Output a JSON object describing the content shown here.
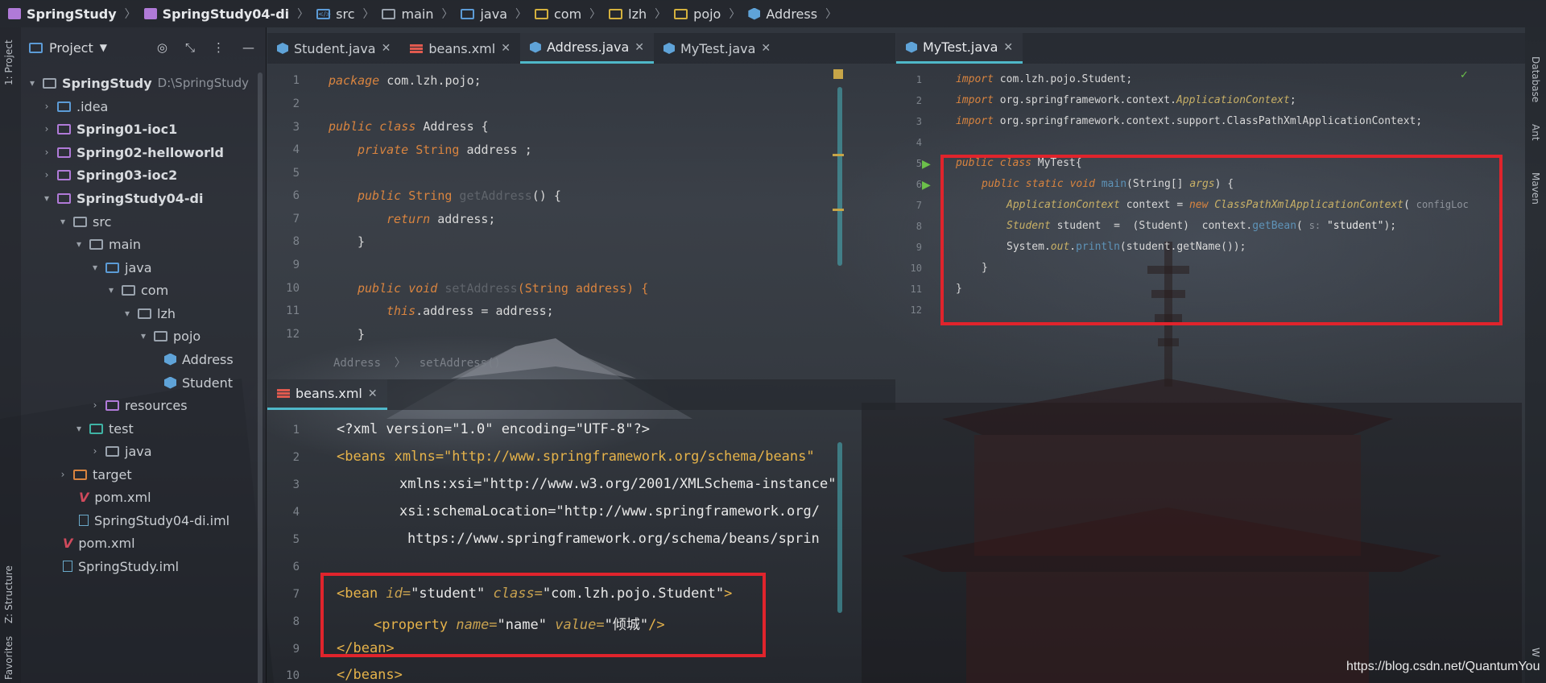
{
  "breadcrumb": [
    "SpringStudy",
    "SpringStudy04-di",
    "src",
    "main",
    "java",
    "com",
    "lzh",
    "pojo",
    "Address"
  ],
  "left_stripe": {
    "project_tab": "1: Project",
    "structure_tab": "Z: Structure",
    "favorites_tab": "Favorites"
  },
  "right_stripe": {
    "database_tab": "Database",
    "ant_tab": "Ant",
    "maven_tab": "Maven",
    "web_tab": "W"
  },
  "project_panel": {
    "title": "Project",
    "tree": [
      {
        "label": "SpringStudy",
        "extra": "D:\\SpringStudy",
        "icon": "module-folder-icon"
      },
      {
        "label": ".idea",
        "icon": "folder-icon"
      },
      {
        "label": "Spring01-ioc1",
        "icon": "module-folder-icon"
      },
      {
        "label": "Spring02-helloworld",
        "icon": "module-folder-icon"
      },
      {
        "label": "Spring03-ioc2",
        "icon": "module-folder-icon"
      },
      {
        "label": "SpringStudy04-di",
        "icon": "module-folder-icon"
      },
      {
        "label": "src",
        "icon": "folder-icon"
      },
      {
        "label": "main",
        "icon": "folder-icon"
      },
      {
        "label": "java",
        "icon": "source-folder-icon"
      },
      {
        "label": "com",
        "icon": "package-icon"
      },
      {
        "label": "lzh",
        "icon": "package-icon"
      },
      {
        "label": "pojo",
        "icon": "package-icon"
      },
      {
        "label": "Address",
        "icon": "class-icon"
      },
      {
        "label": "Student",
        "icon": "class-icon"
      },
      {
        "label": "resources",
        "icon": "resources-folder-icon"
      },
      {
        "label": "test",
        "icon": "test-folder-icon"
      },
      {
        "label": "java",
        "icon": "folder-icon"
      },
      {
        "label": "target",
        "icon": "excluded-folder-icon"
      },
      {
        "label": "pom.xml",
        "icon": "maven-icon"
      },
      {
        "label": "SpringStudy04-di.iml",
        "icon": "iml-icon"
      },
      {
        "label": "pom.xml",
        "icon": "maven-icon"
      },
      {
        "label": "SpringStudy.iml",
        "icon": "iml-icon"
      }
    ]
  },
  "left_editor": {
    "tabs": [
      "Student.java",
      "beans.xml",
      "Address.java",
      "MyTest.java"
    ],
    "active_tab": "Address.java",
    "line_numbers": [
      "1",
      "2",
      "3",
      "4",
      "5",
      "6",
      "7",
      "8",
      "9",
      "10",
      "11",
      "12"
    ],
    "code": {
      "l1": {
        "kw": "package",
        "rest": " com.lzh.pojo;"
      },
      "l3": {
        "kw1": "public",
        "kw2": " class",
        "rest": " Address {"
      },
      "l4": {
        "kw": "private",
        "type": " String",
        "rest": " address ;"
      },
      "l6": {
        "kw": "public",
        "type": " String",
        "fn": " getAddress",
        "rest": "() {"
      },
      "l7": {
        "kw": "return",
        "rest": " address;"
      },
      "l8": {
        "rest": "}"
      },
      "l10": {
        "kw1": "public",
        "kw2": " void",
        "fn": " setAddress",
        "rest": "(String address) {"
      },
      "l11": {
        "kw": "this",
        "rest": ".address = address;"
      },
      "l12": {
        "rest": "}"
      }
    },
    "status_breadcrumb": "Address  〉  setAddress()"
  },
  "xml_editor": {
    "tab": "beans.xml",
    "line_numbers": [
      "1",
      "2",
      "3",
      "4",
      "5",
      "6",
      "7",
      "8",
      "9",
      "10"
    ],
    "code": {
      "l1": "<?xml version=\"1.0\" encoding=\"UTF-8\"?>",
      "l2": "<beans xmlns=\"http://www.springframework.org/schema/beans\"",
      "l3": "xmlns:xsi=\"http://www.w3.org/2001/XMLSchema-instance\"",
      "l4": "xsi:schemaLocation=\"http://www.springframework.org/",
      "l5": "https://www.springframework.org/schema/beans/sprin",
      "l7_tag": "<bean",
      "l7_id_attr": " id=",
      "l7_id_val": "\"student\"",
      "l7_class_attr": " class=",
      "l7_class_val": "\"com.lzh.pojo.Student\"",
      "l7_end": ">",
      "l8_tag": "<property",
      "l8_name_attr": " name=",
      "l8_name_val": "\"name\"",
      "l8_value_attr": " value=",
      "l8_value_val": "\"倾城\"",
      "l8_end": "/>",
      "l9": "</bean>",
      "l10": "</beans>"
    }
  },
  "right_editor": {
    "tab": "MyTest.java",
    "line_numbers": [
      "1",
      "2",
      "3",
      "4",
      "5",
      "6",
      "7",
      "8",
      "9",
      "10",
      "11",
      "12"
    ],
    "code": {
      "l1": {
        "kw": "import",
        "rest": " com.lzh.pojo.Student;"
      },
      "l2": {
        "kw": "import",
        "rest": " org.springframework.context.",
        "cls": "ApplicationContext",
        "end": ";"
      },
      "l3": {
        "kw": "import",
        "rest": " org.springframework.context.support.ClassPathXmlApplicationContext;"
      },
      "l5": {
        "kw1": "public",
        "kw2": " class",
        "rest": " MyTest{"
      },
      "l6": {
        "kw1": "public",
        "kw2": " static",
        "kw3": " void",
        "fn": " main",
        "rest": "(String[] ",
        "arg": "args",
        "end": ") {"
      },
      "l7": {
        "type": "ApplicationContext",
        "mid": " context = ",
        "kw": "new",
        "cls": " ClassPathXmlApplicationContext",
        "end": "( ",
        "hint": "configLoc"
      },
      "l8": {
        "type": "Student",
        "mid": " student  =  (Student)  context.",
        "fn": "getBean",
        "end": "( ",
        "hint": "s:",
        "str": " \"student\"",
        "tail": ");"
      },
      "l9": {
        "sys": "System.",
        "out": "out",
        "mid": ".",
        "fn": "println",
        "end": "(student.getName());"
      },
      "l10": {
        "rest": "}"
      },
      "l11": {
        "rest": "}"
      }
    }
  },
  "watermark": "https://blog.csdn.net/QuantumYou"
}
